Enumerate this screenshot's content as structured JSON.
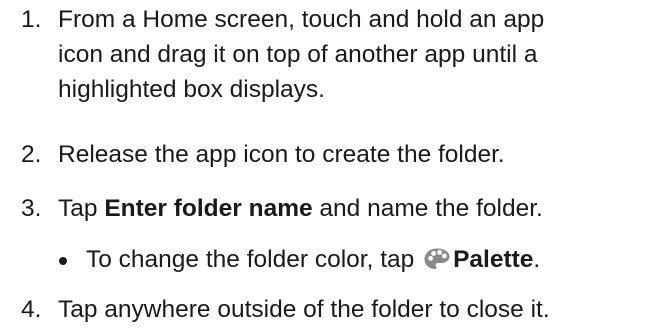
{
  "steps": [
    {
      "number": "1.",
      "line1": "From a Home screen, touch and hold an app",
      "line2": "icon and drag it on top of another app until a",
      "line3": "highlighted box displays."
    },
    {
      "number": "2.",
      "text": "Release the app icon to create the folder."
    },
    {
      "number": "3.",
      "prefix": "Tap ",
      "bold": "Enter folder name",
      "suffix": " and name the folder."
    },
    {
      "number": "4.",
      "text": "Tap anywhere outside of the folder to close it."
    }
  ],
  "bullet": {
    "prefix": "To change the folder color, tap ",
    "icon": "palette-icon",
    "bold": "Palette",
    "suffix": "."
  },
  "colors": {
    "text": "#1a1a1a",
    "icon": "#8a8a8a"
  }
}
